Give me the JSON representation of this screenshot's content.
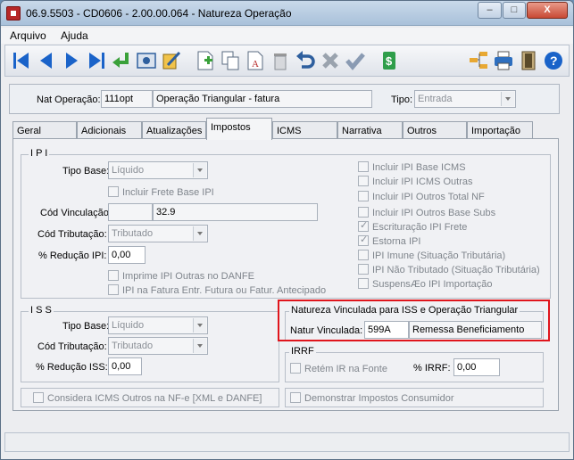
{
  "window": {
    "title": "06.9.5503 - CD0606 - 2.00.00.064 - Natureza Operação",
    "controls": {
      "minimize": "–",
      "maximize": "□",
      "close": "X"
    }
  },
  "menu": [
    "Arquivo",
    "Ajuda"
  ],
  "toolbar": {
    "icons": [
      "first-icon",
      "previous-icon",
      "next-icon",
      "last-icon",
      "enter-icon",
      "photo-icon",
      "edit-icon",
      "new-icon",
      "copy-icon",
      "rename-icon",
      "trash-icon",
      "undo-icon",
      "cancel-icon",
      "confirm-icon",
      "dollar-icon",
      "tree-icon",
      "print-icon",
      "exit-icon",
      "help-icon"
    ],
    "dollar_glyph": "$",
    "help_glyph": "?",
    "rename_glyph": "A"
  },
  "header": {
    "nat_label": "Nat Operação:",
    "nat_code": "111opt",
    "nat_desc": "Operação Triangular - fatura",
    "tipo_label": "Tipo:",
    "tipo_value": "Entrada"
  },
  "tabs": [
    "Geral",
    "Adicionais",
    "Atualizações",
    "Impostos",
    "ICMS",
    "Narrativa",
    "Outros",
    "Importação"
  ],
  "ipi": {
    "title": "I P I",
    "tipo_base_label": "Tipo Base:",
    "tipo_base_value": "Líquido",
    "incluir_frete": "Incluir Frete Base IPI",
    "cod_vinc_label": "Cód Vinculação:",
    "cod_vinc_value": "",
    "cod_vinc_desc": "32.9",
    "cod_trib_label": "Cód Tributação:",
    "cod_trib_value": "Tributado",
    "reducao_label": "% Redução IPI:",
    "reducao_value": "0,00",
    "imprime_danfe": "Imprime IPI Outras no DANFE",
    "ipi_fatura": "IPI na Fatura Entr. Futura ou Fatur. Antecipado",
    "right_checks": [
      {
        "label": "Incluir IPI Base ICMS",
        "checked": false
      },
      {
        "label": "Incluir IPI ICMS Outras",
        "checked": false
      },
      {
        "label": "Incluir IPI Outros Total NF",
        "checked": false
      },
      {
        "label": "Incluir IPI Outros Base Subs",
        "checked": false
      },
      {
        "label": "Escrituração IPI Frete",
        "checked": true
      },
      {
        "label": "Estorna IPI",
        "checked": true
      },
      {
        "label": "IPI Imune (Situação Tributária)",
        "checked": false
      },
      {
        "label": "IPI Não Tributado (Situação Tributária)",
        "checked": false
      },
      {
        "label": "SuspensÆo IPI Importação",
        "checked": false
      }
    ]
  },
  "iss": {
    "title": "I S S",
    "tipo_base_label": "Tipo Base:",
    "tipo_base_value": "Líquido",
    "cod_trib_label": "Cód Tributação:",
    "cod_trib_value": "Tributado",
    "reducao_label": "% Redução ISS:",
    "reducao_value": "0,00"
  },
  "natureza_vinc": {
    "title": "Natureza Vinculada para ISS e Operação Triangular",
    "label": "Natur Vinculada:",
    "code": "599A",
    "desc": "Remessa Beneficiamento"
  },
  "irrf": {
    "title": "IRRF",
    "retem": "Retém IR na Fonte",
    "perc_label": "% IRRF:",
    "perc_value": "0,00"
  },
  "bottom": {
    "considera_icms": "Considera ICMS Outros na NF-e [XML e DANFE]",
    "demonstrar": "Demonstrar Impostos Consumidor"
  },
  "colors": {
    "highlight": "#e0151c",
    "toolbar_blue": "#1a63c9"
  }
}
